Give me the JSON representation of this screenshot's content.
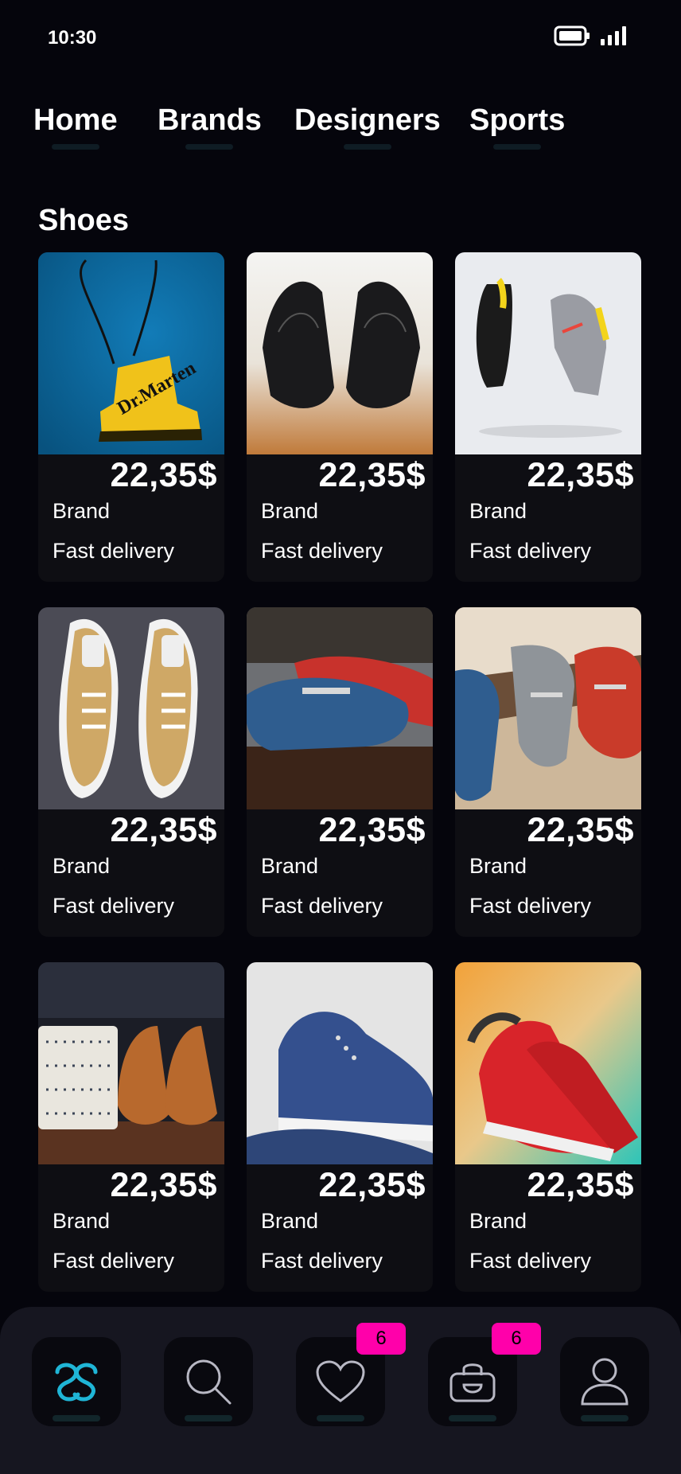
{
  "status": {
    "time": "10:30"
  },
  "nav": {
    "tabs": [
      {
        "label": "Home"
      },
      {
        "label": "Brands"
      },
      {
        "label": "Designers"
      },
      {
        "label": "Sports"
      }
    ]
  },
  "section": {
    "title": "Shoes"
  },
  "products": [
    {
      "price": "22,35$",
      "brand": "Brand",
      "delivery": "Fast delivery",
      "image": "yellow-boot"
    },
    {
      "price": "22,35$",
      "brand": "Brand",
      "delivery": "Fast delivery",
      "image": "black-dress-shoes"
    },
    {
      "price": "22,35$",
      "brand": "Brand",
      "delivery": "Fast delivery",
      "image": "floating-sneakers"
    },
    {
      "price": "22,35$",
      "brand": "Brand",
      "delivery": "Fast delivery",
      "image": "tan-canvas-sneakers"
    },
    {
      "price": "22,35$",
      "brand": "Brand",
      "delivery": "Fast delivery",
      "image": "blue-red-loafers"
    },
    {
      "price": "22,35$",
      "brand": "Brand",
      "delivery": "Fast delivery",
      "image": "grey-red-loafers"
    },
    {
      "price": "22,35$",
      "brand": "Brand",
      "delivery": "Fast delivery",
      "image": "brown-oxfords-shirts"
    },
    {
      "price": "22,35$",
      "brand": "Brand",
      "delivery": "Fast delivery",
      "image": "blue-canvas-sneakers"
    },
    {
      "price": "22,35$",
      "brand": "Brand",
      "delivery": "Fast delivery",
      "image": "red-running-shoes"
    }
  ],
  "bottom_nav": {
    "items": [
      {
        "icon": "logo-icon"
      },
      {
        "icon": "search-icon"
      },
      {
        "icon": "heart-icon",
        "badge": "6"
      },
      {
        "icon": "bag-icon",
        "badge": "6"
      },
      {
        "icon": "profile-icon"
      }
    ]
  },
  "colors": {
    "accent": "#1fb5d6",
    "badge": "#ff00aa",
    "background": "#05050c",
    "card": "#0e0e13"
  }
}
